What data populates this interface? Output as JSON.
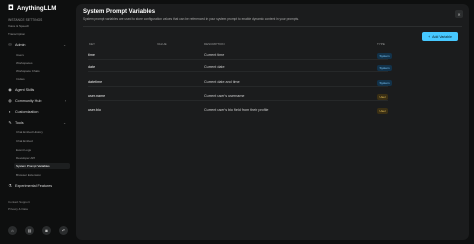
{
  "app": {
    "logo_glyph": "◘",
    "name": "AnythingLLM"
  },
  "sidebar": {
    "instance_settings_label": "INSTANCE SETTINGS",
    "voice_speech": "Voice & Speech",
    "transcription": "Transcription",
    "admin": "Admin",
    "admin_items": [
      "Users",
      "Workspaces",
      "Workspace Chats",
      "Invites"
    ],
    "agent_skills": "Agent Skills",
    "community_hub": "Community Hub",
    "customization": "Customization",
    "tools": "Tools",
    "tools_items": [
      "Chat Embed History",
      "Chat Embed",
      "Event Logs",
      "Developer API",
      "System Prompt Variables",
      "Browser Extension"
    ],
    "experimental": "Experimental Features",
    "contact_support": "Contact Support",
    "privacy": "Privacy & Data"
  },
  "main": {
    "title": "System Prompt Variables",
    "description": "System prompt variables are used to store configuration values that can be referenced in your system prompt to enable dynamic content in your prompts.",
    "add_button": "Add Variable",
    "columns": {
      "key": "KEY",
      "value": "VALUE",
      "description": "DESCRIPTION",
      "type": "TYPE"
    },
    "rows": [
      {
        "key": "time",
        "value": "",
        "description": "Current time",
        "type": "System"
      },
      {
        "key": "date",
        "value": "",
        "description": "Current date",
        "type": "System"
      },
      {
        "key": "datetime",
        "value": "",
        "description": "Current date and time",
        "type": "System"
      },
      {
        "key": "user.name",
        "value": "",
        "description": "Current user's username",
        "type": "User"
      },
      {
        "key": "user.bio",
        "value": "",
        "description": "Current user's bio field from their profile",
        "type": "User"
      }
    ]
  },
  "colors": {
    "accent": "#46c8ff",
    "system_badge": "#7ecbff",
    "user_badge": "#e8c15a"
  }
}
